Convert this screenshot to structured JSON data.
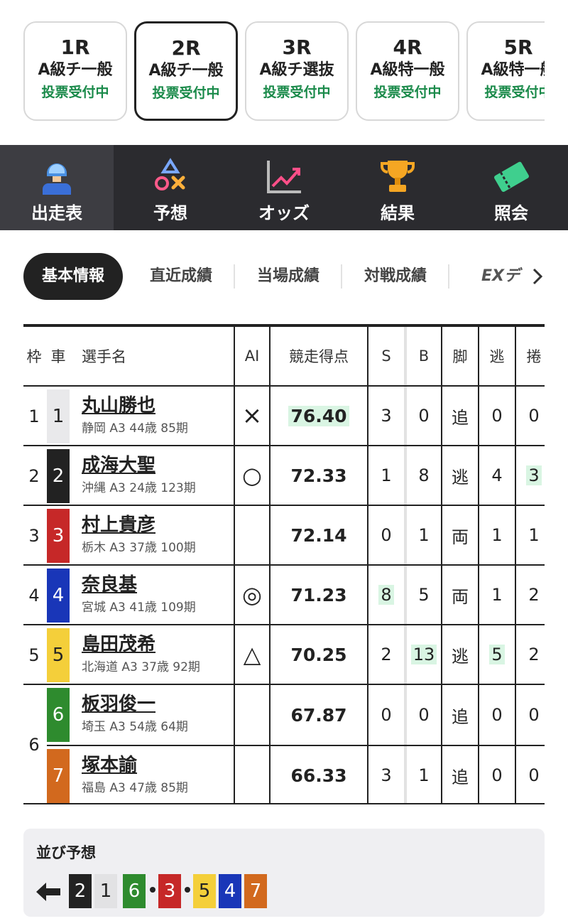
{
  "races": [
    {
      "num": "1R",
      "class": "A級チ一般",
      "status": "投票受付中",
      "active": false
    },
    {
      "num": "2R",
      "class": "A級チ一般",
      "status": "投票受付中",
      "active": true
    },
    {
      "num": "3R",
      "class": "A級チ選抜",
      "status": "投票受付中",
      "active": false
    },
    {
      "num": "4R",
      "class": "A級特一般",
      "status": "投票受付中",
      "active": false
    },
    {
      "num": "5R",
      "class": "A級特一般",
      "status": "投票受付中",
      "active": false
    }
  ],
  "nav": [
    {
      "label": "出走表",
      "icon": "racer-icon",
      "active": true
    },
    {
      "label": "予想",
      "icon": "prediction-icon",
      "active": false
    },
    {
      "label": "オッズ",
      "icon": "odds-chart-icon",
      "active": false
    },
    {
      "label": "結果",
      "icon": "trophy-icon",
      "active": false
    },
    {
      "label": "照会",
      "icon": "ticket-icon",
      "active": false
    }
  ],
  "subtabs": [
    {
      "label": "基本情報",
      "active": true
    },
    {
      "label": "直近成績",
      "active": false
    },
    {
      "label": "当場成績",
      "active": false
    },
    {
      "label": "対戦成績",
      "active": false
    },
    {
      "label": "EXデ",
      "active": false
    }
  ],
  "table": {
    "headers": {
      "waku": "枠",
      "car": "車",
      "name": "選手名",
      "ai": "AI",
      "score": "競走得点",
      "s": "S",
      "b": "B",
      "kyaku": "脚",
      "nige": "逃",
      "makuri": "捲"
    },
    "rows": [
      {
        "waku": "1",
        "car": "1",
        "name": "丸山勝也",
        "info": "静岡 A3 44歳 85期",
        "ai": "×",
        "score": "76.40",
        "s": "3",
        "b": "0",
        "kyaku": "追",
        "nige": "0",
        "makuri": "0"
      },
      {
        "waku": "2",
        "car": "2",
        "name": "成海大聖",
        "info": "沖縄 A3 24歳 123期",
        "ai": "○",
        "score": "72.33",
        "s": "1",
        "b": "8",
        "kyaku": "逃",
        "nige": "4",
        "makuri": "3"
      },
      {
        "waku": "3",
        "car": "3",
        "name": "村上貴彦",
        "info": "栃木 A3 37歳 100期",
        "ai": "",
        "score": "72.14",
        "s": "0",
        "b": "1",
        "kyaku": "両",
        "nige": "1",
        "makuri": "1"
      },
      {
        "waku": "4",
        "car": "4",
        "name": "奈良基",
        "info": "宮城 A3 41歳 109期",
        "ai": "◎",
        "score": "71.23",
        "s": "8",
        "b": "5",
        "kyaku": "両",
        "nige": "1",
        "makuri": "2"
      },
      {
        "waku": "5",
        "car": "5",
        "name": "島田茂希",
        "info": "北海道 A3 37歳 92期",
        "ai": "△",
        "score": "70.25",
        "s": "2",
        "b": "13",
        "kyaku": "逃",
        "nige": "5",
        "makuri": "2"
      },
      {
        "waku": "6",
        "car": "6",
        "name": "板羽俊一",
        "info": "埼玉 A3 54歳 64期",
        "ai": "",
        "score": "67.87",
        "s": "0",
        "b": "0",
        "kyaku": "追",
        "nige": "0",
        "makuri": "0"
      },
      {
        "waku": "",
        "car": "7",
        "name": "塚本諭",
        "info": "福島 A3 47歳 85期",
        "ai": "",
        "score": "66.33",
        "s": "3",
        "b": "1",
        "kyaku": "追",
        "nige": "0",
        "makuri": "0"
      }
    ]
  },
  "line_prediction": {
    "title": "並び予想",
    "sequence": [
      "2",
      "1",
      "6",
      "3",
      "5",
      "4",
      "7"
    ]
  },
  "colors": {
    "car1": "#e9e9eb",
    "car2": "#222222",
    "car3": "#c62828",
    "car4": "#1936b8",
    "car5": "#f4cf3a",
    "car6": "#2e8b2e",
    "car7": "#d2691e",
    "highlight": "#d9f5e3",
    "status_green": "#1a8a4a"
  }
}
